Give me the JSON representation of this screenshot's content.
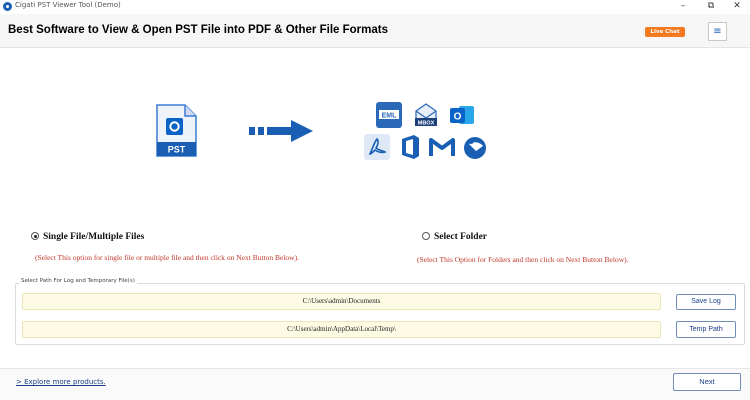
{
  "window": {
    "title": "Cigati PST Viewer Tool (Demo)",
    "min_glyph": "–",
    "max_glyph": "⧉",
    "close_glyph": "✕"
  },
  "header": {
    "headline": "Best Software to View & Open PST File into PDF & Other File Formats",
    "live_chat_label": "Live Chat",
    "menu_glyph": "≡"
  },
  "illustration": {
    "source_label": "PST",
    "target_icons": [
      {
        "name": "eml-icon",
        "label": "EML"
      },
      {
        "name": "mbox-icon",
        "label": "MBOX"
      },
      {
        "name": "outlook-icon",
        "label": "O"
      },
      {
        "name": "pdf-icon",
        "label": ""
      },
      {
        "name": "office365-icon",
        "label": ""
      },
      {
        "name": "gmail-icon",
        "label": "M"
      },
      {
        "name": "thunderbird-icon",
        "label": ""
      }
    ]
  },
  "options": {
    "single": {
      "label": "Single File/Multiple Files",
      "hint": "(Select This option for single file or multiple file and then click on Next Button Below).",
      "selected": true
    },
    "folder": {
      "label": "Select Folder",
      "hint": "(Select This Option for Folders and then click on Next Button Below).",
      "selected": false
    }
  },
  "paths": {
    "legend": "Select Path For Log and Temporary File(s)",
    "log_path": "C:\\Users\\admin\\Documents",
    "log_button": "Save Log",
    "temp_path": "C:\\Users\\admin\\AppData\\Local\\Temp\\",
    "temp_button": "Temp Path"
  },
  "footer": {
    "explore_link": "> Explore more products.",
    "next_button": "Next"
  },
  "colors": {
    "accent_blue": "#1a5fb4",
    "hint_red": "#c0392b",
    "live_chat_orange": "#f47a20",
    "path_field_bg": "#fdfbe3"
  }
}
